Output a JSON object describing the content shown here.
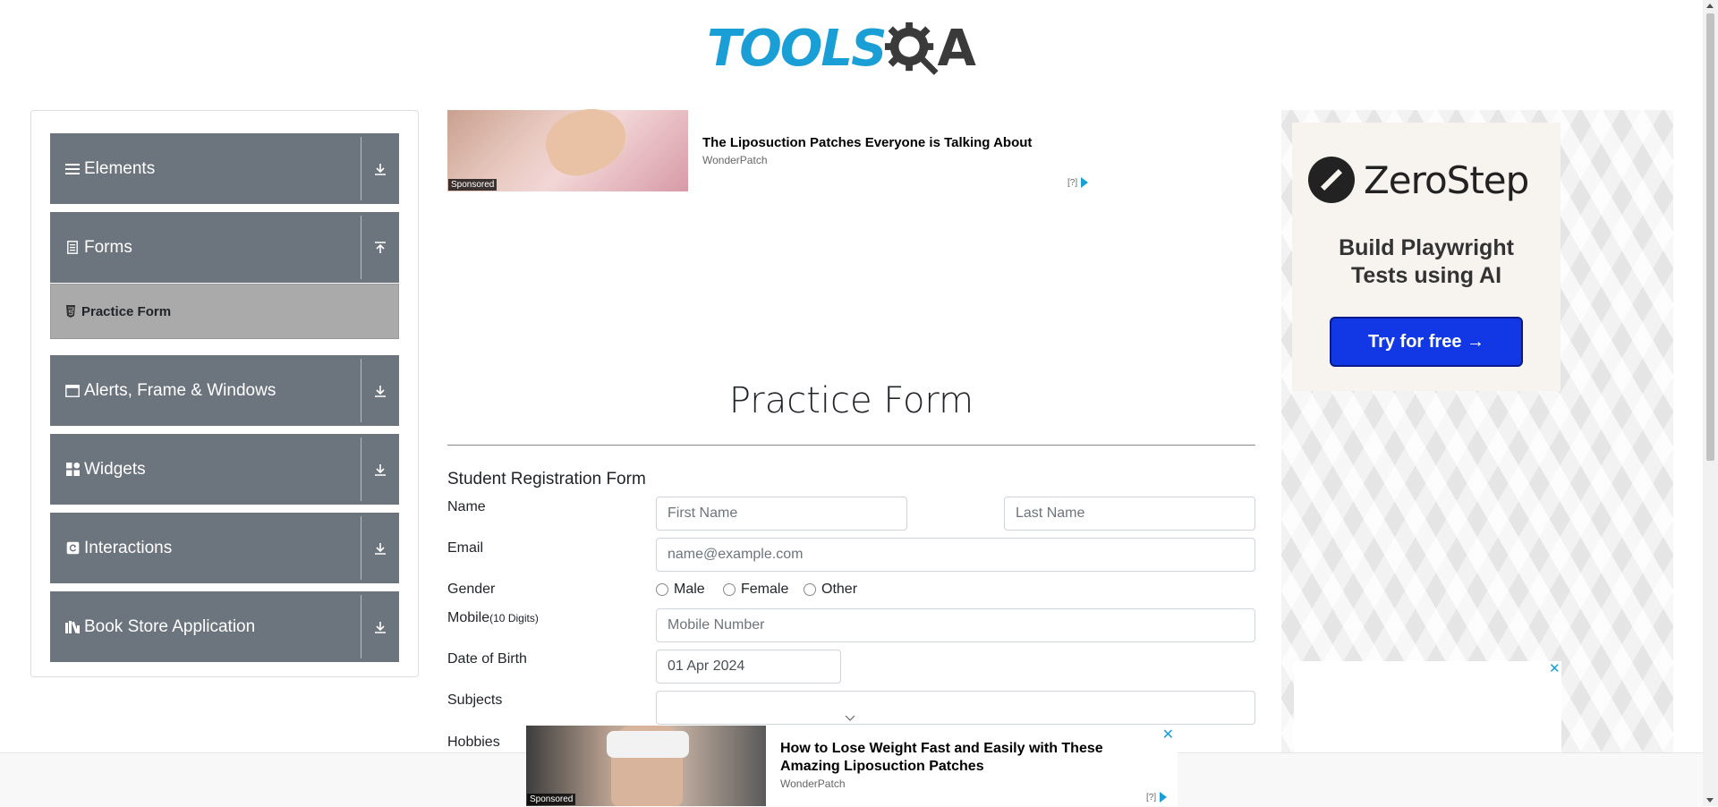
{
  "header": {
    "logo_part1": "TOOLS",
    "logo_part2": "A"
  },
  "sidebar": {
    "groups": [
      {
        "label": "Elements",
        "icon": "hamburger-icon",
        "expanded": false
      },
      {
        "label": "Forms",
        "icon": "document-icon",
        "expanded": true
      },
      {
        "label": "Alerts, Frame & Windows",
        "icon": "window-icon",
        "expanded": false
      },
      {
        "label": "Widgets",
        "icon": "grid-icon",
        "expanded": false
      },
      {
        "label": "Interactions",
        "icon": "refresh-icon",
        "expanded": false
      },
      {
        "label": "Book Store Application",
        "icon": "books-icon",
        "expanded": false
      }
    ],
    "subitem": {
      "label": "Practice Form",
      "icon": "html5-icon"
    }
  },
  "ad_top": {
    "title": "The Liposuction Patches Everyone is Talking About",
    "source": "WonderPatch",
    "sponsored": "Sponsored",
    "choice": "[?]"
  },
  "main": {
    "page_title": "Practice Form",
    "form_title": "Student Registration Form",
    "labels": {
      "name": "Name",
      "email": "Email",
      "gender": "Gender",
      "mobile": "Mobile",
      "mobile_hint": "(10 Digits)",
      "dob": "Date of Birth",
      "subjects": "Subjects",
      "hobbies": "Hobbies"
    },
    "placeholders": {
      "first_name": "First Name",
      "last_name": "Last Name",
      "email": "name@example.com",
      "mobile": "Mobile Number"
    },
    "dob_value": "01 Apr 2024",
    "gender_options": [
      "Male",
      "Female",
      "Other"
    ]
  },
  "right_ad": {
    "brand": "ZeroStep",
    "tagline_line1": "Build Playwright",
    "tagline_line2": "Tests using AI",
    "cta": "Try for free →",
    "close": "✕"
  },
  "ad_bottom": {
    "title": "How to Lose Weight Fast and Easily with These Amazing Liposuction Patches",
    "source": "WonderPatch",
    "sponsored": "Sponsored",
    "choice": "[?]",
    "close": "✕"
  },
  "colors": {
    "accent": "#1a9ed6",
    "sidebar_group": "#6c757d",
    "sidebar_active": "#aaaaaa",
    "cta": "#1238e6"
  }
}
